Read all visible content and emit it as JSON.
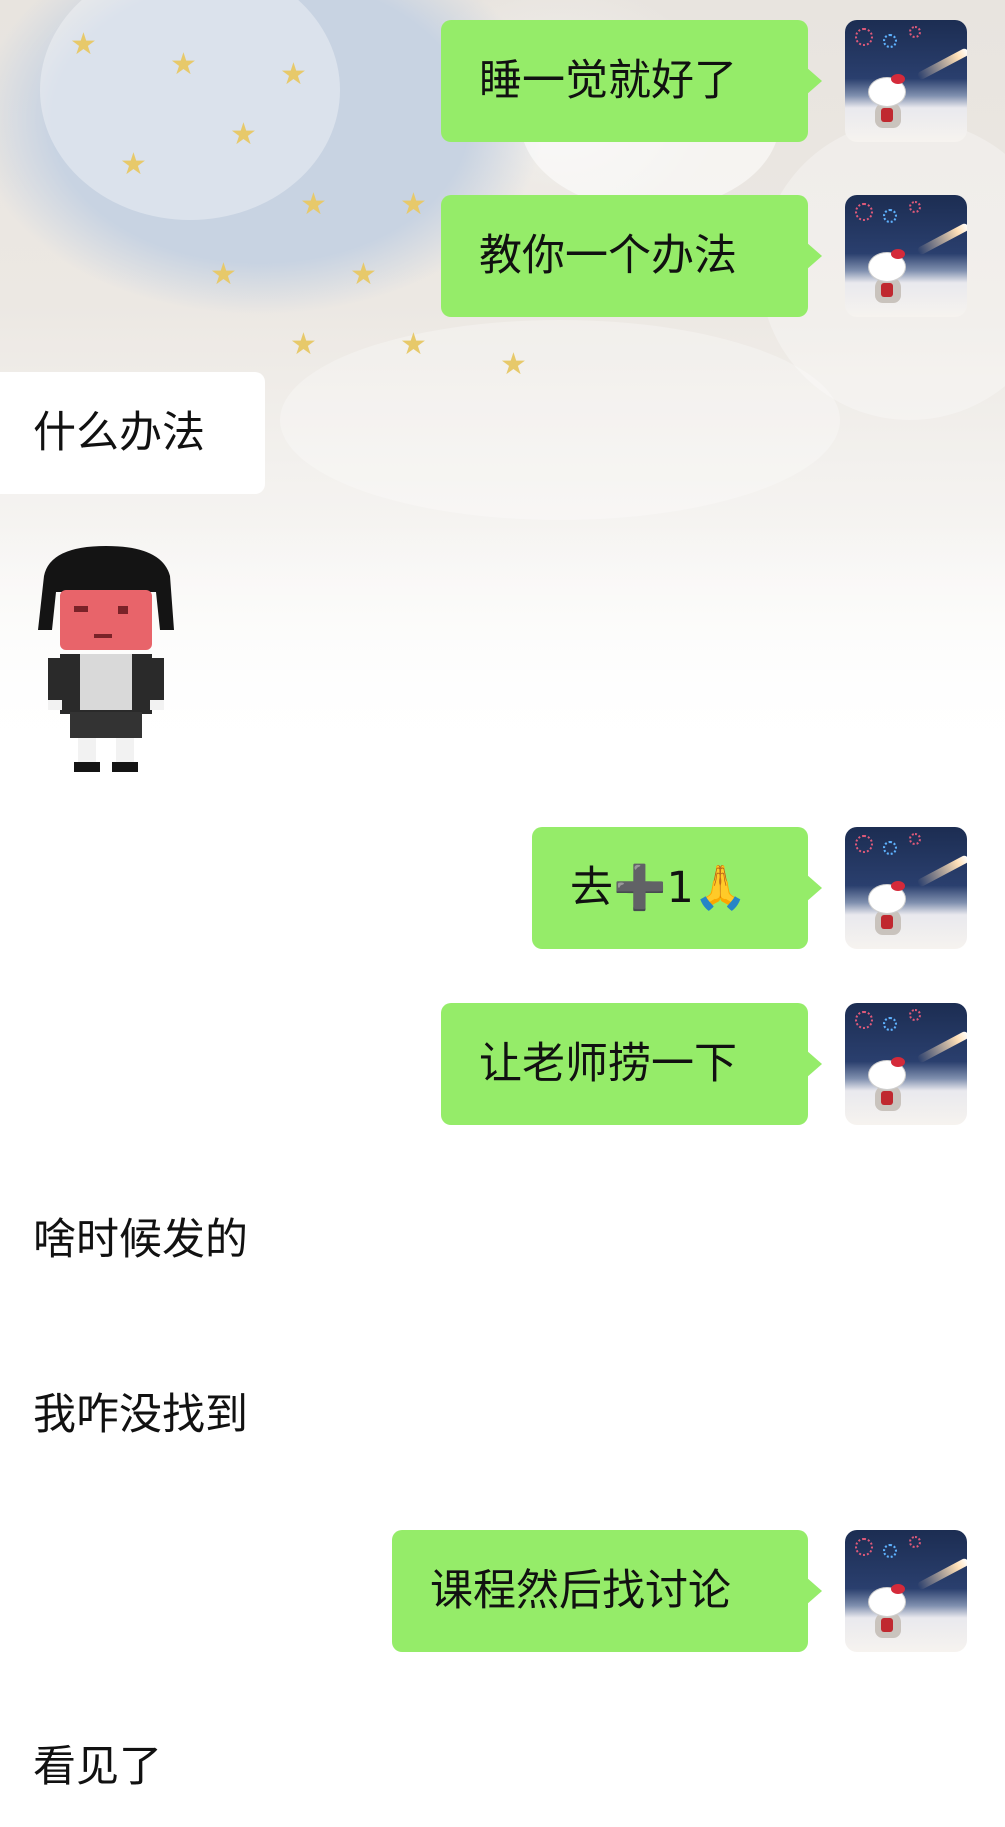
{
  "colors": {
    "my_bubble": "#95ec69",
    "other_bubble": "#ffffff",
    "text": "#111111"
  },
  "messages": [
    {
      "sender": "me",
      "text": "睡一觉就好了"
    },
    {
      "sender": "me",
      "text": "教你一个办法"
    },
    {
      "sender": "other",
      "text": "什么办法"
    },
    {
      "sender": "other",
      "type": "sticker",
      "icon": "pixel-cartoon-boy-sticker"
    },
    {
      "sender": "me",
      "text": "去➕1🙏"
    },
    {
      "sender": "me",
      "text": "让老师捞一下"
    },
    {
      "sender": "other",
      "text": "啥时候发的"
    },
    {
      "sender": "other",
      "text": "我咋没找到"
    },
    {
      "sender": "me",
      "text": "课程然后找讨论"
    },
    {
      "sender": "other",
      "text": "看见了"
    }
  ],
  "avatar": {
    "icon": "hello-kitty-avatar"
  }
}
